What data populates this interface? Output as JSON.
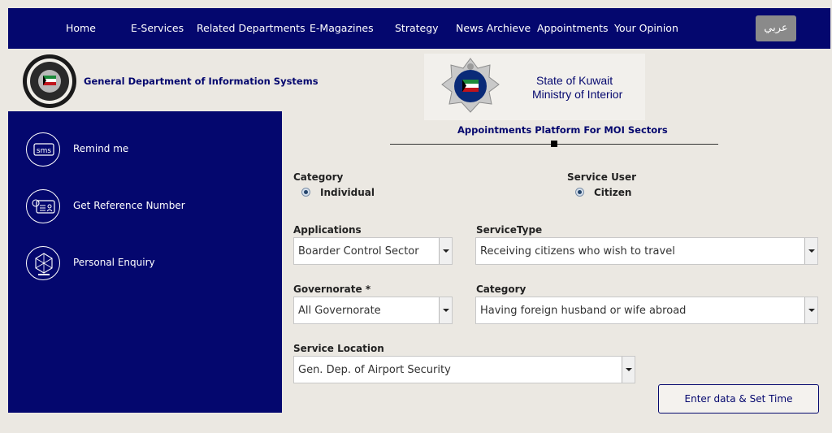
{
  "nav": {
    "items": [
      {
        "label": "Home"
      },
      {
        "label": "E-Services"
      },
      {
        "label": "Related Departments"
      },
      {
        "label": "E-Magazines"
      },
      {
        "label": "Strategy"
      },
      {
        "label": "News Archieve"
      },
      {
        "label": "Appointments"
      },
      {
        "label": "Your Opinion"
      }
    ],
    "language_button": "عربي"
  },
  "header": {
    "department_title": "General Department of Information Systems",
    "banner_line1": "State of Kuwait",
    "banner_line2": "Ministry of Interior"
  },
  "platform_title": "Appointments Platform For MOI Sectors",
  "sidebar": {
    "items": [
      {
        "label": "Remind me",
        "icon": "sms-icon",
        "icon_text": "sms"
      },
      {
        "label": "Get Reference Number",
        "icon": "reference-card-icon"
      },
      {
        "label": "Personal Enquiry",
        "icon": "enquiry-icon"
      }
    ]
  },
  "form": {
    "category_label": "Category",
    "category_value": "Individual",
    "service_user_label": "Service User",
    "service_user_value": "Citizen",
    "applications_label": "Applications",
    "applications_value": "Boarder Control Sector",
    "service_type_label": "ServiceType",
    "service_type_value": "Receiving citizens who wish to travel",
    "governorate_label": "Governorate *",
    "governorate_value": "All Governorate",
    "category2_label": "Category",
    "category2_value": "Having foreign husband or wife abroad",
    "service_location_label": "Service Location",
    "service_location_value": "Gen. Dep. of Airport Security",
    "submit_label": "Enter data & Set Time"
  },
  "colors": {
    "navy": "#04076e",
    "page_background": "#ebe8e2"
  }
}
